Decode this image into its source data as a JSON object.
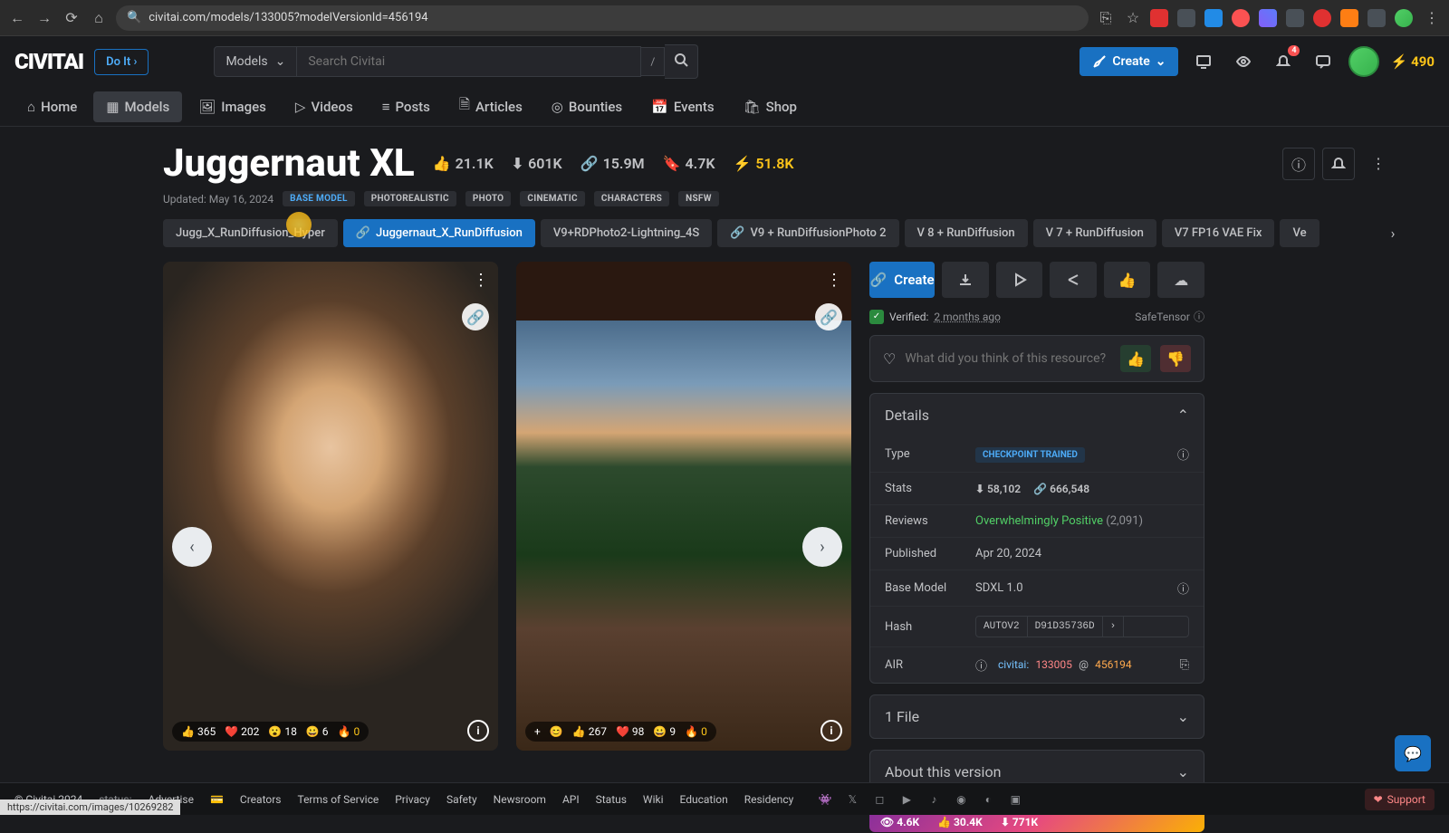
{
  "browser": {
    "url": "civitai.com/models/133005?modelVersionId=456194",
    "status_url": "https://civitai.com/images/10269282"
  },
  "header": {
    "logo": "CIVITAI",
    "doit": "Do It",
    "search_cat": "Models",
    "search_ph": "Search Civitai",
    "kbd": "/",
    "create": "Create",
    "notif_badge": "4",
    "buzz": "490"
  },
  "nav": {
    "items": [
      "Home",
      "Models",
      "Images",
      "Videos",
      "Posts",
      "Articles",
      "Bounties",
      "Events",
      "Shop"
    ]
  },
  "model": {
    "title": "Juggernaut XL",
    "stats": {
      "likes": "21.1K",
      "downloads": "601K",
      "links": "15.9M",
      "bookmarks": "4.7K",
      "buzz": "51.8K"
    },
    "updated": "Updated: May 16, 2024",
    "tags": [
      "BASE MODEL",
      "PHOTOREALISTIC",
      "PHOTO",
      "CINEMATIC",
      "CHARACTERS",
      "NSFW"
    ]
  },
  "versions": [
    "Jugg_X_RunDiffusion_Hyper",
    "Juggernaut_X_RunDiffusion",
    "V9+RDPhoto2-Lightning_4S",
    "V9 + RunDiffusionPhoto 2",
    "V 8 + RunDiffusion",
    "V 7 + RunDiffusion",
    "V7 FP16 VAE Fix",
    "Ve"
  ],
  "gallery": {
    "img1_reacts": [
      [
        "👍",
        "365"
      ],
      [
        "❤️",
        "202"
      ],
      [
        "😮",
        "18"
      ],
      [
        "😀",
        "6"
      ],
      [
        "🔥",
        "0"
      ]
    ],
    "img2_reacts": [
      [
        "👍",
        "267"
      ],
      [
        "❤️",
        "98"
      ],
      [
        "😀",
        "9"
      ],
      [
        "🔥",
        "0"
      ]
    ],
    "add": "+"
  },
  "sidebar": {
    "create": "Create",
    "verified": "Verified:",
    "verified_when": "2 months ago",
    "safetensor": "SafeTensor",
    "review_ph": "What did you think of this resource?",
    "details": {
      "title": "Details",
      "type_k": "Type",
      "type_v": "CHECKPOINT TRAINED",
      "stats_k": "Stats",
      "stats_dl": "58,102",
      "stats_link": "666,548",
      "reviews_k": "Reviews",
      "reviews_v": "Overwhelmingly Positive",
      "reviews_n": "(2,091)",
      "pub_k": "Published",
      "pub_v": "Apr 20, 2024",
      "bm_k": "Base Model",
      "bm_v": "SDXL 1.0",
      "hash_k": "Hash",
      "hash_t": "AUTOV2",
      "hash_v": "D91D35736D",
      "air_k": "AIR",
      "air_1": "civitai:",
      "air_2": "133005",
      "air_at": "@",
      "air_3": "456194"
    },
    "file": "1 File",
    "about": "About this version",
    "bs": {
      "views": "4.6K",
      "dl": "30.4K",
      "gen": "771K"
    }
  },
  "footer": {
    "copy": "© Civitai 2024",
    "status": "status:",
    "links": [
      "Advertise",
      "Creators",
      "Terms of Service",
      "Privacy",
      "Safety",
      "Newsroom",
      "API",
      "Status",
      "Wiki",
      "Education",
      "Residency"
    ],
    "support": "Support"
  }
}
